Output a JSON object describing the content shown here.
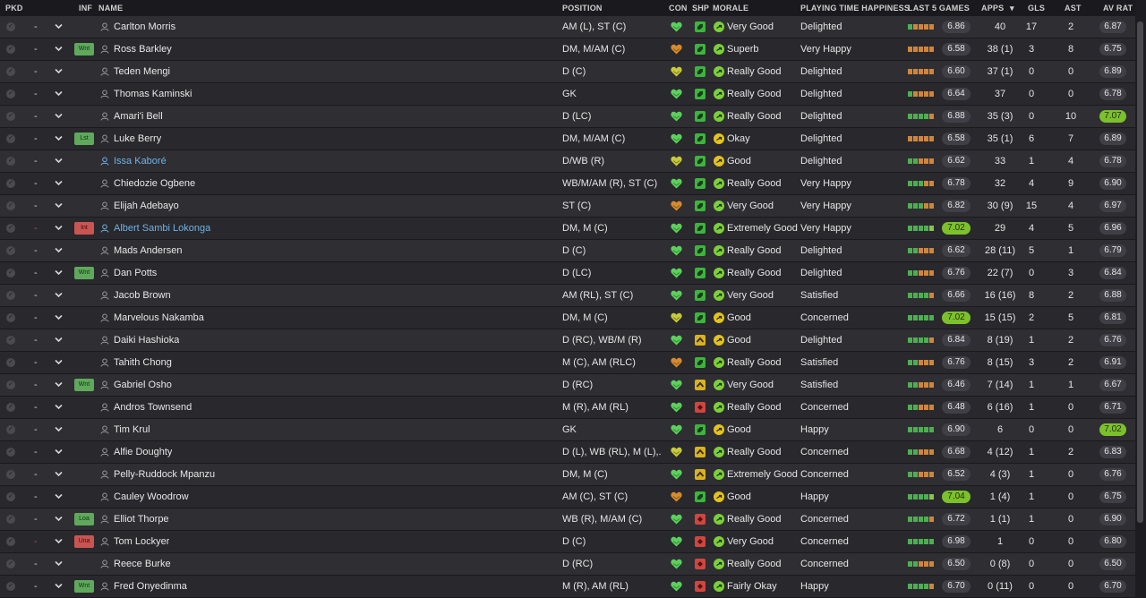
{
  "columns": {
    "pkd": "PKD",
    "inf": "INF",
    "name": "NAME",
    "position": "POSITION",
    "con": "CON",
    "shp": "SHP",
    "morale": "MORALE",
    "playing_time": "PLAYING TIME HAPPINESS",
    "last5": "LAST 5 GAMES",
    "apps": "APPS",
    "gls": "GLS",
    "ast": "AST",
    "avrat": "AV RAT"
  },
  "colors": {
    "form_green": "#4caf50",
    "form_lightgreen": "#8bc34a",
    "form_orange": "#d1853a",
    "con_green": "#5bd15b",
    "con_yellow": "#c9c93a",
    "con_orange": "#d98a2b",
    "shp_green": "#3db43d",
    "shp_yellow": "#d8b223",
    "shp_red": "#d0463f",
    "link_blue": "#6fb3e6",
    "rating_high": "#7cc12b"
  },
  "players": [
    {
      "pkd": "-",
      "inf": "",
      "name": "Carlton Morris",
      "link": false,
      "position": "AM (L), ST (C)",
      "con": "green",
      "shp": "green",
      "morale_icon": "green",
      "morale": "Very Good",
      "happiness": "Delighted",
      "form": "goooo",
      "last": "6.86",
      "apps": "40",
      "gls": "17",
      "ast": "2",
      "avrat": "6.87"
    },
    {
      "pkd": "-",
      "inf": "Wnt",
      "inf_color": "g",
      "name": "Ross Barkley",
      "link": false,
      "position": "DM, M/AM (C)",
      "con": "orange",
      "shp": "green",
      "morale_icon": "green",
      "morale": "Superb",
      "happiness": "Very Happy",
      "form": "ooooo",
      "last": "6.58",
      "apps": "38 (1)",
      "gls": "3",
      "ast": "8",
      "avrat": "6.75"
    },
    {
      "pkd": "-",
      "inf": "",
      "name": "Teden Mengi",
      "link": false,
      "position": "D (C)",
      "con": "yellow",
      "shp": "green",
      "morale_icon": "green",
      "morale": "Really Good",
      "happiness": "Delighted",
      "form": "ooooo",
      "last": "6.60",
      "apps": "37 (1)",
      "gls": "0",
      "ast": "0",
      "avrat": "6.89"
    },
    {
      "pkd": "-",
      "inf": "",
      "name": "Thomas Kaminski",
      "link": false,
      "position": "GK",
      "con": "green",
      "shp": "green",
      "morale_icon": "green",
      "morale": "Really Good",
      "happiness": "Delighted",
      "form": "goooo",
      "last": "6.64",
      "apps": "37",
      "gls": "0",
      "ast": "0",
      "avrat": "6.78"
    },
    {
      "pkd": "-",
      "inf": "",
      "name": "Amari'i Bell",
      "link": false,
      "position": "D (LC)",
      "con": "green",
      "shp": "green",
      "morale_icon": "green",
      "morale": "Really Good",
      "happiness": "Delighted",
      "form": "ggggo",
      "last": "6.88",
      "apps": "35 (3)",
      "gls": "0",
      "ast": "10",
      "avrat": "7.07",
      "avrat_hi": true
    },
    {
      "pkd": "-",
      "inf": "Lst",
      "inf_color": "g",
      "name": "Luke Berry",
      "link": false,
      "position": "DM, M/AM (C)",
      "con": "green",
      "shp": "green",
      "morale_icon": "yellow",
      "morale": "Okay",
      "happiness": "Delighted",
      "form": "ooooo",
      "last": "6.58",
      "apps": "35 (1)",
      "gls": "6",
      "ast": "7",
      "avrat": "6.89"
    },
    {
      "pkd": "-",
      "inf": "",
      "name": "Issa Kaboré",
      "link": true,
      "position": "D/WB (R)",
      "con": "yellow",
      "shp": "green",
      "morale_icon": "yellow",
      "morale": "Good",
      "happiness": "Delighted",
      "form": "ggooo",
      "last": "6.62",
      "apps": "33",
      "gls": "1",
      "ast": "4",
      "avrat": "6.78"
    },
    {
      "pkd": "-",
      "inf": "",
      "name": "Chiedozie Ogbene",
      "link": false,
      "position": "WB/M/AM (R), ST (C)",
      "con": "green",
      "shp": "green",
      "morale_icon": "green",
      "morale": "Really Good",
      "happiness": "Very Happy",
      "form": "gggoo",
      "last": "6.78",
      "apps": "32",
      "gls": "4",
      "ast": "9",
      "avrat": "6.90"
    },
    {
      "pkd": "-",
      "inf": "",
      "name": "Elijah Adebayo",
      "link": false,
      "position": "ST (C)",
      "con": "orange",
      "shp": "green",
      "morale_icon": "green",
      "morale": "Very Good",
      "happiness": "Very Happy",
      "form": "gggoo",
      "last": "6.82",
      "apps": "30 (9)",
      "gls": "15",
      "ast": "4",
      "avrat": "6.97"
    },
    {
      "pkd": "-",
      "pkd_red": true,
      "inf": "Int",
      "inf_color": "r",
      "name": "Albert Sambi Lokonga",
      "link": true,
      "position": "DM, M (C)",
      "con": "green",
      "shp": "green",
      "morale_icon": "green",
      "morale": "Extremely Good",
      "happiness": "Very Happy",
      "form": "ggggl",
      "last": "7.02",
      "last_hi": true,
      "apps": "29",
      "gls": "4",
      "ast": "5",
      "avrat": "6.96"
    },
    {
      "pkd": "-",
      "inf": "",
      "name": "Mads Andersen",
      "link": false,
      "position": "D (C)",
      "con": "green",
      "shp": "green",
      "morale_icon": "green",
      "morale": "Really Good",
      "happiness": "Delighted",
      "form": "ggooo",
      "last": "6.62",
      "apps": "28 (11)",
      "gls": "5",
      "ast": "1",
      "avrat": "6.79"
    },
    {
      "pkd": "-",
      "inf": "Wnt",
      "inf_color": "g",
      "name": "Dan Potts",
      "link": false,
      "position": "D (LC)",
      "con": "green",
      "shp": "green",
      "morale_icon": "green",
      "morale": "Really Good",
      "happiness": "Delighted",
      "form": "ggooo",
      "last": "6.76",
      "apps": "22 (7)",
      "gls": "0",
      "ast": "3",
      "avrat": "6.84"
    },
    {
      "pkd": "-",
      "inf": "",
      "name": "Jacob Brown",
      "link": false,
      "position": "AM (RL), ST (C)",
      "con": "green",
      "shp": "green",
      "morale_icon": "green",
      "morale": "Very Good",
      "happiness": "Satisfied",
      "form": "ggggo",
      "last": "6.66",
      "apps": "16 (16)",
      "gls": "8",
      "ast": "2",
      "avrat": "6.88"
    },
    {
      "pkd": "-",
      "inf": "",
      "name": "Marvelous Nakamba",
      "link": false,
      "position": "DM, M (C)",
      "con": "yellow",
      "shp": "green",
      "morale_icon": "yellow",
      "morale": "Good",
      "happiness": "Concerned",
      "form": "ggggg",
      "last": "7.02",
      "last_hi": true,
      "apps": "15 (15)",
      "gls": "2",
      "ast": "5",
      "avrat": "6.81"
    },
    {
      "pkd": "-",
      "inf": "",
      "name": "Daiki Hashioka",
      "link": false,
      "position": "D (RC), WB/M (R)",
      "con": "green",
      "shp": "yellow",
      "morale_icon": "yellow",
      "morale": "Good",
      "happiness": "Delighted",
      "form": "ggggo",
      "last": "6.84",
      "apps": "8 (19)",
      "gls": "1",
      "ast": "2",
      "avrat": "6.76"
    },
    {
      "pkd": "-",
      "inf": "",
      "name": "Tahith Chong",
      "link": false,
      "position": "M (C), AM (RLC)",
      "con": "orange",
      "shp": "green",
      "morale_icon": "green",
      "morale": "Really Good",
      "happiness": "Satisfied",
      "form": "ggooo",
      "last": "6.76",
      "apps": "8 (15)",
      "gls": "3",
      "ast": "2",
      "avrat": "6.91"
    },
    {
      "pkd": "-",
      "inf": "Wnt",
      "inf_color": "g",
      "name": "Gabriel Osho",
      "link": false,
      "position": "D (RC)",
      "con": "green",
      "shp": "yellow",
      "morale_icon": "green",
      "morale": "Very Good",
      "happiness": "Satisfied",
      "form": "ggooo",
      "last": "6.46",
      "apps": "7 (14)",
      "gls": "1",
      "ast": "1",
      "avrat": "6.67"
    },
    {
      "pkd": "-",
      "inf": "",
      "name": "Andros Townsend",
      "link": false,
      "position": "M (R), AM (RL)",
      "con": "green",
      "shp": "red",
      "morale_icon": "green",
      "morale": "Really Good",
      "happiness": "Concerned",
      "form": "ggooo",
      "last": "6.48",
      "apps": "6 (16)",
      "gls": "1",
      "ast": "0",
      "avrat": "6.71"
    },
    {
      "pkd": "-",
      "inf": "",
      "name": "Tim Krul",
      "link": false,
      "position": "GK",
      "con": "green",
      "shp": "green",
      "morale_icon": "yellow",
      "morale": "Good",
      "happiness": "Happy",
      "form": "ggggg",
      "last": "6.90",
      "apps": "6",
      "gls": "0",
      "ast": "0",
      "avrat": "7.02",
      "avrat_hi": true
    },
    {
      "pkd": "-",
      "inf": "",
      "name": "Alfie Doughty",
      "link": false,
      "position": "D (L), WB (RL), M (L),...",
      "con": "yellow",
      "shp": "yellow",
      "morale_icon": "green",
      "morale": "Really Good",
      "happiness": "Concerned",
      "form": "ggooo",
      "last": "6.68",
      "apps": "4 (12)",
      "gls": "1",
      "ast": "2",
      "avrat": "6.83"
    },
    {
      "pkd": "-",
      "inf": "",
      "name": "Pelly-Ruddock Mpanzu",
      "link": false,
      "position": "DM, M (C)",
      "con": "green",
      "shp": "yellow",
      "morale_icon": "green",
      "morale": "Extremely Good",
      "happiness": "Concerned",
      "form": "ggooo",
      "last": "6.52",
      "apps": "4 (3)",
      "gls": "1",
      "ast": "0",
      "avrat": "6.76"
    },
    {
      "pkd": "-",
      "inf": "",
      "name": "Cauley Woodrow",
      "link": false,
      "position": "AM (C), ST (C)",
      "con": "orange",
      "shp": "green",
      "morale_icon": "yellow",
      "morale": "Good",
      "happiness": "Happy",
      "form": "ggggl",
      "last": "7.04",
      "last_hi": true,
      "apps": "1 (4)",
      "gls": "1",
      "ast": "0",
      "avrat": "6.75"
    },
    {
      "pkd": "-",
      "inf": "Loa",
      "inf_color": "g",
      "name": "Elliot Thorpe",
      "link": false,
      "position": "WB (R), M/AM (C)",
      "con": "green",
      "shp": "red",
      "morale_icon": "green",
      "morale": "Really Good",
      "happiness": "Concerned",
      "form": "ggggo",
      "last": "6.72",
      "apps": "1 (1)",
      "gls": "1",
      "ast": "0",
      "avrat": "6.90"
    },
    {
      "pkd": "-",
      "pkd_red": true,
      "inf": "Una",
      "inf_color": "r",
      "name": "Tom Lockyer",
      "link": false,
      "position": "D (C)",
      "con": "green",
      "shp": "red",
      "morale_icon": "green",
      "morale": "Very Good",
      "happiness": "Concerned",
      "form": "ggggg",
      "last": "6.98",
      "apps": "1",
      "gls": "0",
      "ast": "0",
      "avrat": "6.80"
    },
    {
      "pkd": "-",
      "inf": "",
      "name": "Reece Burke",
      "link": false,
      "position": "D (RC)",
      "con": "green",
      "shp": "red",
      "morale_icon": "green",
      "morale": "Really Good",
      "happiness": "Concerned",
      "form": "ggooo",
      "last": "6.50",
      "apps": "0 (8)",
      "gls": "0",
      "ast": "0",
      "avrat": "6.50"
    },
    {
      "pkd": "-",
      "inf": "Wnt",
      "inf_color": "g",
      "name": "Fred Onyedinma",
      "link": false,
      "position": "M (R), AM (RL)",
      "con": "green",
      "shp": "red",
      "morale_icon": "green",
      "morale": "Fairly Okay",
      "happiness": "Happy",
      "form": "ggggo",
      "last": "6.70",
      "apps": "0 (11)",
      "gls": "0",
      "ast": "0",
      "avrat": "6.70"
    }
  ]
}
